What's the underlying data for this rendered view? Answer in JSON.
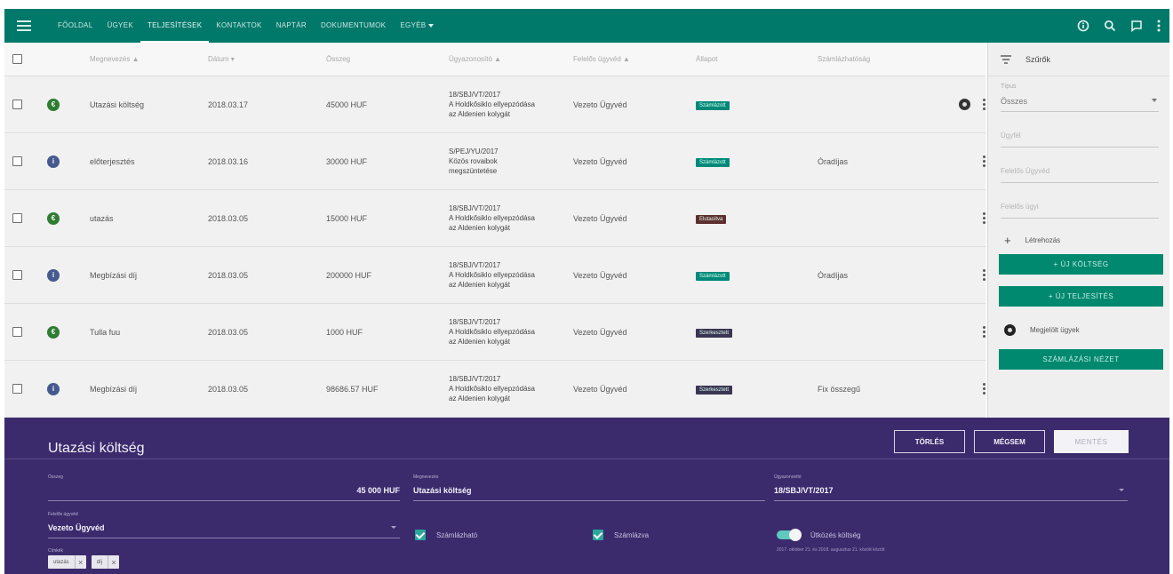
{
  "topbar": {
    "nav": [
      {
        "label": "Főoldal",
        "name": "nav-fooldal",
        "active": false
      },
      {
        "label": "Ügyek",
        "name": "nav-ugyek",
        "active": false
      },
      {
        "label": "Teljesítések",
        "name": "nav-teljesitesek",
        "active": true
      },
      {
        "label": "Kontaktok",
        "name": "nav-kontaktok",
        "active": false
      },
      {
        "label": "Naptár",
        "name": "nav-naptar",
        "active": false
      },
      {
        "label": "Dokumentumok",
        "name": "nav-dokumentumok",
        "active": false
      },
      {
        "label": "Egyéb",
        "name": "nav-egyeb",
        "active": false,
        "dropdown": true
      }
    ],
    "icons": [
      "info-icon",
      "search-icon",
      "chat-icon",
      "more-vert-icon"
    ]
  },
  "table": {
    "headers": {
      "name": "Megnevezés ▲",
      "date": "Dátum ▾",
      "amount": "Összeg",
      "case": "Ügyazonosító ▲",
      "lawyer": "Felelős ügyvéd ▲",
      "state": "Állapot",
      "invoice": "Számlázhatóság"
    },
    "rows": [
      {
        "icon": "euro",
        "name": "Utazási költség",
        "date": "2018.03.17",
        "amount": "45000 HUF",
        "case": [
          "18/SBJ/VT/2017",
          "A Holdkősiklo ellyepzódása",
          "az Aldenien kolygát"
        ],
        "lawyer": "Vezeto Ügyvéd",
        "state": "Számlázott",
        "state_color": "green",
        "invoice": "",
        "gear": true
      },
      {
        "icon": "info",
        "name": "előterjesztés",
        "date": "2018.03.16",
        "amount": "30000 HUF",
        "case": [
          "S/PEJ/YU/2017",
          "Közös rovaibok",
          "megszüntetése"
        ],
        "lawyer": "Vezeto Ügyvéd",
        "state": "Számlázott",
        "state_color": "green",
        "invoice": "Óradíjas",
        "gear": false
      },
      {
        "icon": "euro",
        "name": "utazás",
        "date": "2018.03.05",
        "amount": "15000 HUF",
        "case": [
          "18/SBJ/VT/2017",
          "A Holdkősiklo ellyepzódása",
          "az Aldenien kolygát"
        ],
        "lawyer": "Vezeto Ügyvéd",
        "state": "Elutasítva",
        "state_color": "red",
        "invoice": "",
        "gear": false
      },
      {
        "icon": "info",
        "name": "Megbízási díj",
        "date": "2018.03.05",
        "amount": "200000 HUF",
        "case": [
          "18/SBJ/VT/2017",
          "A Holdkősiklo ellyepzódása",
          "az Aldenien kolygát"
        ],
        "lawyer": "Vezeto Ügyvéd",
        "state": "Számlázott",
        "state_color": "green",
        "invoice": "Óradíjas",
        "gear": false
      },
      {
        "icon": "euro",
        "name": "Tulla fuu",
        "date": "2018.03.05",
        "amount": "1000 HUF",
        "case": [
          "18/SBJ/VT/2017",
          "A Holdkősiklo ellyepzódása",
          "az Aldenien kolygát"
        ],
        "lawyer": "Vezeto Ügyvéd",
        "state": "Szerkesztett",
        "state_color": "dark",
        "invoice": "",
        "gear": false
      },
      {
        "icon": "info",
        "name": "Megbízási díj",
        "date": "2018.03.05",
        "amount": "98686.57 HUF",
        "case": [
          "18/SBJ/VT/2017",
          "A Holdkősiklo ellyepzódása",
          "az Aldenien kolygát"
        ],
        "lawyer": "Vezeto Ügyvéd",
        "state": "Szerkesztett",
        "state_color": "dark",
        "invoice": "Fix összegű",
        "gear": false
      }
    ]
  },
  "panel": {
    "filter_label": "Szűrők",
    "type_label": "Típus",
    "type_value": "Összes",
    "field_client": "Ügyfél",
    "field_lawyer": "Felelős Ügyvéd",
    "field_case": "Felelős ügyi",
    "create_label": "Létrehozás",
    "btn_new_cost": "+ Új költség",
    "btn_new_perf": "+ Új teljesítés",
    "marked_label": "Megjelölt ügyek",
    "btn_invoice_view": "Számlázási nézet"
  },
  "detail": {
    "title": "Utazási költség",
    "btn_delete": "Törlés",
    "btn_cancel": "Mégsem",
    "btn_save": "Mentés",
    "amount_label": "Összeg",
    "amount_value": "45 000 HUF",
    "name_label": "Megnevezés",
    "name_value": "Utazási költség",
    "case_label": "Ügyazonosító",
    "case_value": "18/SBJ/VT/2017",
    "lawyer_label": "Felelős ügyvéd",
    "lawyer_value": "Vezeto Ügyvéd",
    "check_billable": "Számlázható",
    "check_invoiced": "Számlázva",
    "toggle_label": "Ütközés költség",
    "toggle_hint": "2017. október 21. és 2018. augusztus 21. között között",
    "tags_label": "Címkék",
    "tags": [
      "utazás",
      "díj"
    ]
  }
}
